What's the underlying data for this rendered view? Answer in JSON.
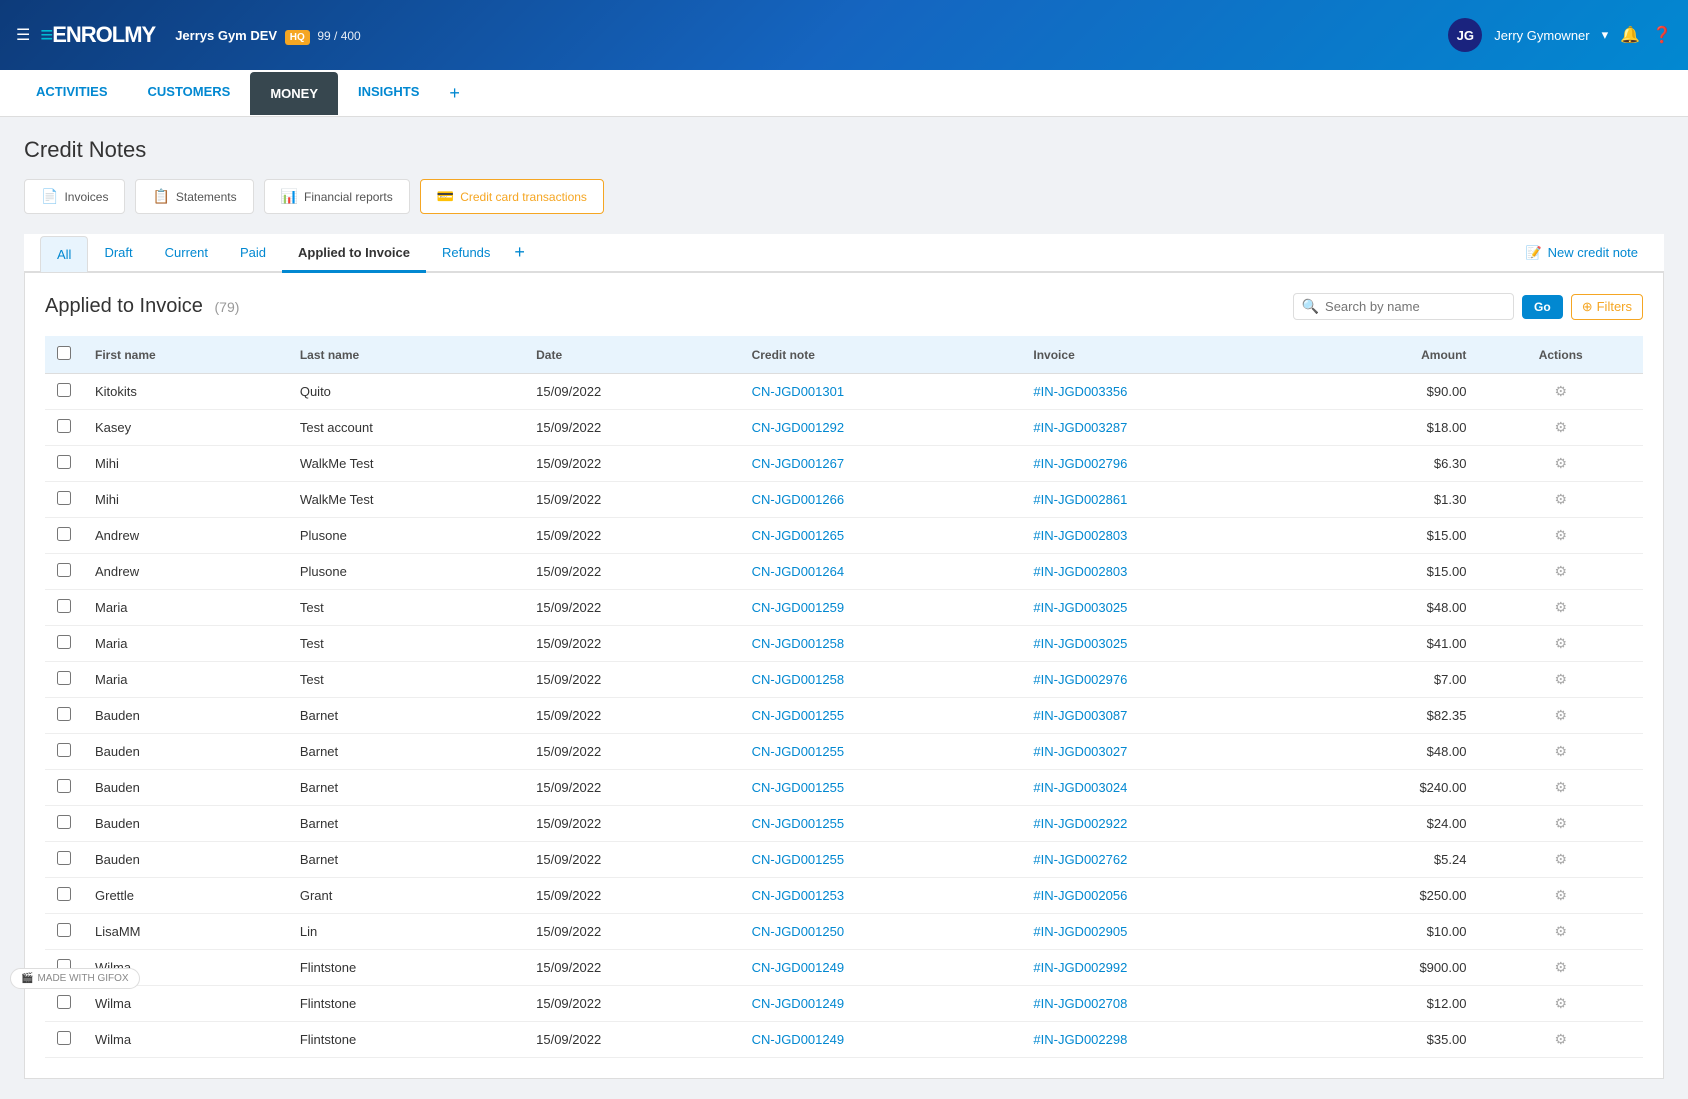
{
  "header": {
    "logo": "ENROLMY",
    "gym_name": "Jerrys Gym DEV",
    "hq_badge": "HQ",
    "count": "99 / 400",
    "user_initials": "JG",
    "user_name": "Jerry Gymowner"
  },
  "nav": {
    "items": [
      {
        "label": "ACTIVITIES",
        "active": false
      },
      {
        "label": "CUSTOMERS",
        "active": false
      },
      {
        "label": "MONEY",
        "active": true
      },
      {
        "label": "INSIGHTS",
        "active": false
      }
    ],
    "plus": "+"
  },
  "quick_nav": [
    {
      "label": "Invoices",
      "icon": "📄",
      "active": false
    },
    {
      "label": "Statements",
      "icon": "📋",
      "active": false
    },
    {
      "label": "Financial reports",
      "icon": "📊",
      "active": false
    },
    {
      "label": "Credit card transactions",
      "icon": "💳",
      "active": false
    }
  ],
  "page_title": "Credit Notes",
  "tabs": [
    {
      "label": "All",
      "active": false
    },
    {
      "label": "Draft",
      "active": false
    },
    {
      "label": "Current",
      "active": false
    },
    {
      "label": "Paid",
      "active": false
    },
    {
      "label": "Applied to Invoice",
      "active": true
    },
    {
      "label": "Refunds",
      "active": false
    }
  ],
  "new_credit_label": "New credit note",
  "section": {
    "title": "Applied to Invoice",
    "count": "(79)",
    "search_placeholder": "Search by name",
    "go_button": "Go",
    "filters_label": "Filters"
  },
  "table": {
    "columns": [
      "First name",
      "Last name",
      "Date",
      "Credit note",
      "Invoice",
      "Amount",
      "Actions"
    ],
    "rows": [
      {
        "first": "Kitokits",
        "last": "Quito",
        "date": "15/09/2022",
        "credit_note": "CN-JGD001301",
        "invoice": "#IN-JGD003356",
        "amount": "$90.00"
      },
      {
        "first": "Kasey",
        "last": "Test account",
        "date": "15/09/2022",
        "credit_note": "CN-JGD001292",
        "invoice": "#IN-JGD003287",
        "amount": "$18.00"
      },
      {
        "first": "Mihi",
        "last": "WalkMe Test",
        "date": "15/09/2022",
        "credit_note": "CN-JGD001267",
        "invoice": "#IN-JGD002796",
        "amount": "$6.30"
      },
      {
        "first": "Mihi",
        "last": "WalkMe Test",
        "date": "15/09/2022",
        "credit_note": "CN-JGD001266",
        "invoice": "#IN-JGD002861",
        "amount": "$1.30"
      },
      {
        "first": "Andrew",
        "last": "Plusone",
        "date": "15/09/2022",
        "credit_note": "CN-JGD001265",
        "invoice": "#IN-JGD002803",
        "amount": "$15.00"
      },
      {
        "first": "Andrew",
        "last": "Plusone",
        "date": "15/09/2022",
        "credit_note": "CN-JGD001264",
        "invoice": "#IN-JGD002803",
        "amount": "$15.00"
      },
      {
        "first": "Maria",
        "last": "Test",
        "date": "15/09/2022",
        "credit_note": "CN-JGD001259",
        "invoice": "#IN-JGD003025",
        "amount": "$48.00"
      },
      {
        "first": "Maria",
        "last": "Test",
        "date": "15/09/2022",
        "credit_note": "CN-JGD001258",
        "invoice": "#IN-JGD003025",
        "amount": "$41.00"
      },
      {
        "first": "Maria",
        "last": "Test",
        "date": "15/09/2022",
        "credit_note": "CN-JGD001258",
        "invoice": "#IN-JGD002976",
        "amount": "$7.00"
      },
      {
        "first": "Bauden",
        "last": "Barnet",
        "date": "15/09/2022",
        "credit_note": "CN-JGD001255",
        "invoice": "#IN-JGD003087",
        "amount": "$82.35"
      },
      {
        "first": "Bauden",
        "last": "Barnet",
        "date": "15/09/2022",
        "credit_note": "CN-JGD001255",
        "invoice": "#IN-JGD003027",
        "amount": "$48.00"
      },
      {
        "first": "Bauden",
        "last": "Barnet",
        "date": "15/09/2022",
        "credit_note": "CN-JGD001255",
        "invoice": "#IN-JGD003024",
        "amount": "$240.00"
      },
      {
        "first": "Bauden",
        "last": "Barnet",
        "date": "15/09/2022",
        "credit_note": "CN-JGD001255",
        "invoice": "#IN-JGD002922",
        "amount": "$24.00"
      },
      {
        "first": "Bauden",
        "last": "Barnet",
        "date": "15/09/2022",
        "credit_note": "CN-JGD001255",
        "invoice": "#IN-JGD002762",
        "amount": "$5.24"
      },
      {
        "first": "Grettle",
        "last": "Grant",
        "date": "15/09/2022",
        "credit_note": "CN-JGD001253",
        "invoice": "#IN-JGD002056",
        "amount": "$250.00"
      },
      {
        "first": "LisaMM",
        "last": "Lin",
        "date": "15/09/2022",
        "credit_note": "CN-JGD001250",
        "invoice": "#IN-JGD002905",
        "amount": "$10.00"
      },
      {
        "first": "Wilma",
        "last": "Flintstone",
        "date": "15/09/2022",
        "credit_note": "CN-JGD001249",
        "invoice": "#IN-JGD002992",
        "amount": "$900.00"
      },
      {
        "first": "Wilma",
        "last": "Flintstone",
        "date": "15/09/2022",
        "credit_note": "CN-JGD001249",
        "invoice": "#IN-JGD002708",
        "amount": "$12.00"
      },
      {
        "first": "Wilma",
        "last": "Flintstone",
        "date": "15/09/2022",
        "credit_note": "CN-JGD001249",
        "invoice": "#IN-JGD002298",
        "amount": "$35.00"
      }
    ]
  }
}
